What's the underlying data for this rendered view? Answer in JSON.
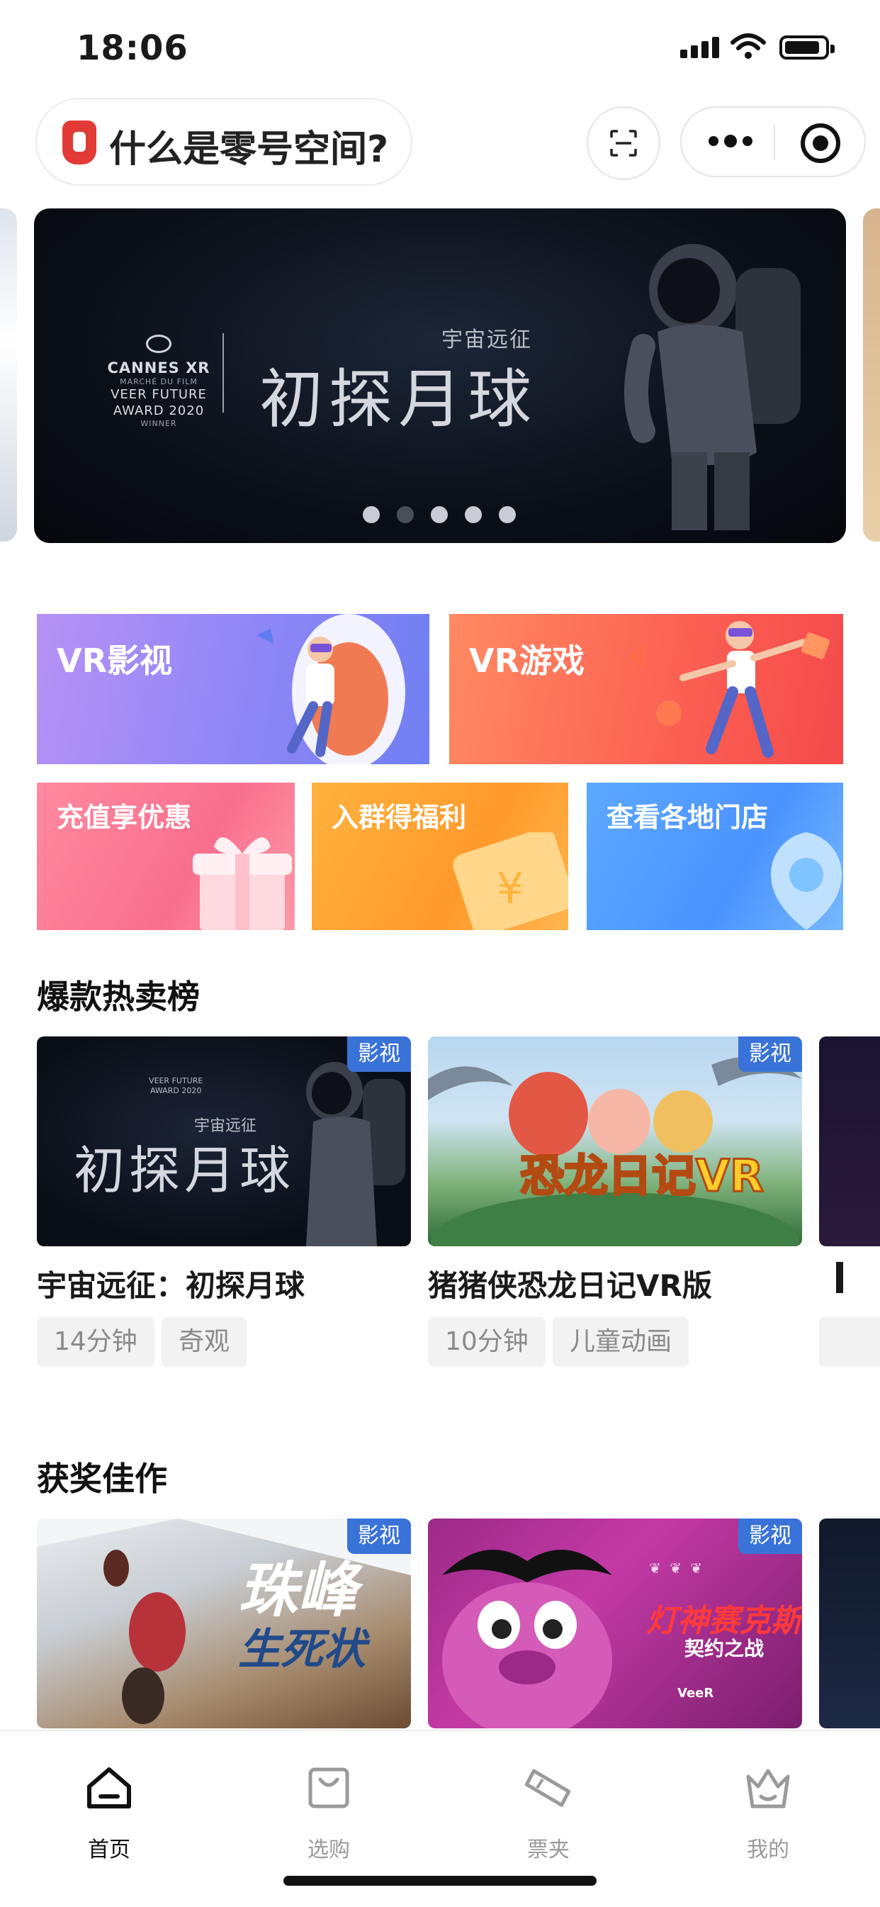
{
  "status_bar": {
    "time": "18:06"
  },
  "header": {
    "title": "什么是零号空间?"
  },
  "banner": {
    "award_lines": [
      "CANNES XR",
      "MARCHÉ DU FILM",
      "VEER FUTURE",
      "AWARD 2020",
      "WINNER"
    ],
    "subtitle": "宇宙远征",
    "title": "初探月球",
    "slide_count": 5,
    "active_slide": 2
  },
  "categories": {
    "vr_movie": "VR影视",
    "vr_game": "VR游戏",
    "recharge": "充值享优惠",
    "join_group": "入群得福利",
    "stores": "查看各地门店"
  },
  "hot_section": {
    "title": "爆款热卖榜",
    "cards": [
      {
        "tag": "影视",
        "title": "宇宙远征：初探月球",
        "image_award": [
          "VEER FUTURE",
          "AWARD 2020"
        ],
        "image_subtitle": "宇宙远征",
        "image_title": "初探月球",
        "chips": [
          "14分钟",
          "奇观"
        ]
      },
      {
        "tag": "影视",
        "title": "猪猪侠恐龙日记VR版",
        "image_text": "恐龙日记VR",
        "chips": [
          "10分钟",
          "儿童动画"
        ]
      }
    ]
  },
  "award_section": {
    "title": "获奖佳作",
    "cards": [
      {
        "tag": "影视",
        "image_title_1": "珠峰",
        "image_title_2": "生死状"
      },
      {
        "tag": "影视",
        "image_title_1": "灯神赛克斯",
        "image_title_2": "契约之战",
        "image_brand": "VeeR"
      }
    ]
  },
  "tabbar": {
    "items": [
      {
        "label": "首页",
        "icon": "home-icon",
        "active": true
      },
      {
        "label": "选购",
        "icon": "shopping-bag-icon",
        "active": false
      },
      {
        "label": "票夹",
        "icon": "ticket-icon",
        "active": false
      },
      {
        "label": "我的",
        "icon": "crown-user-icon",
        "active": false
      }
    ]
  },
  "colors": {
    "accent_red": "#e23b37",
    "tag_blue": "#3a73d8",
    "vr_movie": "#8e86f6",
    "vr_game": "#fb5f52",
    "recharge": "#f86f8d",
    "join_group": "#ff9a2b",
    "stores": "#4b93ff"
  }
}
